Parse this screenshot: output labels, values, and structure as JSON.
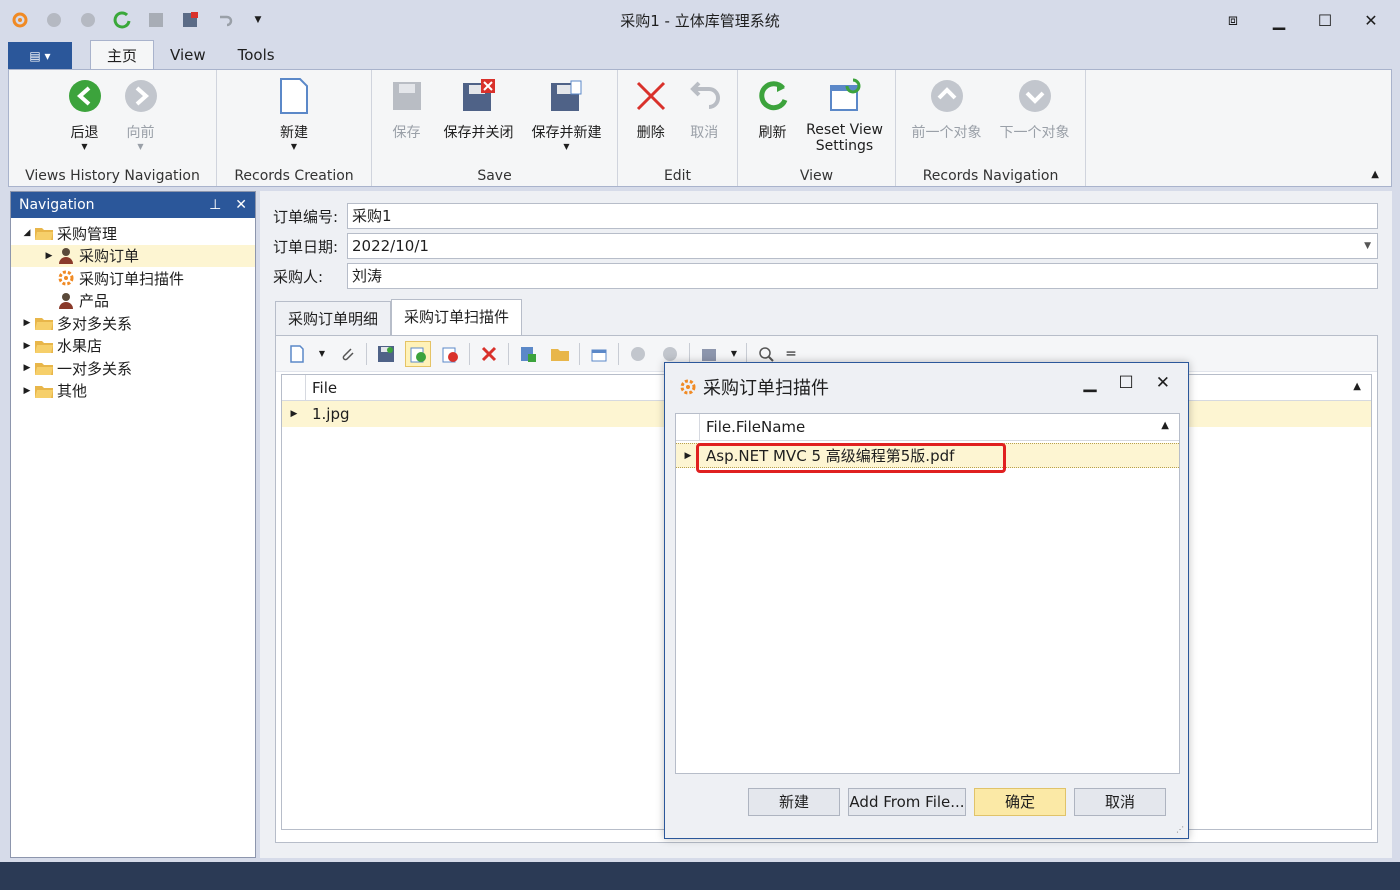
{
  "window": {
    "title": "采购1 - 立体库管理系统",
    "controls": [
      "restore-ribbon",
      "minimize",
      "maximize",
      "close"
    ]
  },
  "ribbon": {
    "tabs": [
      {
        "label": "主页",
        "active": true
      },
      {
        "label": "View",
        "active": false
      },
      {
        "label": "Tools",
        "active": false
      }
    ],
    "groups": {
      "history": {
        "title": "Views History Navigation",
        "back": "后退",
        "forward": "向前"
      },
      "creation": {
        "title": "Records Creation",
        "new": "新建"
      },
      "save": {
        "title": "Save",
        "save": "保存",
        "save_close": "保存并关闭",
        "save_new": "保存并新建"
      },
      "edit": {
        "title": "Edit",
        "delete": "删除",
        "cancel": "取消"
      },
      "view": {
        "title": "View",
        "refresh": "刷新",
        "reset_line1": "Reset View",
        "reset_line2": "Settings"
      },
      "records_nav": {
        "title": "Records Navigation",
        "prev": "前一个对象",
        "next": "下一个对象"
      }
    }
  },
  "navigation": {
    "title": "Navigation",
    "items": [
      {
        "label": "采购管理",
        "level": 0,
        "expanded": true,
        "icon": "folder-icon"
      },
      {
        "label": "采购订单",
        "level": 1,
        "selected": true,
        "icon": "user-icon"
      },
      {
        "label": "采购订单扫描件",
        "level": 1,
        "icon": "gear-icon"
      },
      {
        "label": "产品",
        "level": 1,
        "icon": "user-icon"
      },
      {
        "label": "多对多关系",
        "level": 0,
        "icon": "folder-icon"
      },
      {
        "label": "水果店",
        "level": 0,
        "icon": "folder-icon"
      },
      {
        "label": "一对多关系",
        "level": 0,
        "icon": "folder-icon"
      },
      {
        "label": "其他",
        "level": 0,
        "icon": "folder-icon"
      }
    ]
  },
  "form": {
    "order_no_label": "订单编号:",
    "order_no": "采购1",
    "order_date_label": "订单日期:",
    "order_date": "2022/10/1",
    "buyer_label": "采购人:",
    "buyer": "刘涛"
  },
  "tabs": [
    {
      "label": "采购订单明细",
      "active": false
    },
    {
      "label": "采购订单扫描件",
      "active": true
    }
  ],
  "file_grid": {
    "column": "File",
    "rows": [
      "1.jpg"
    ]
  },
  "dialog": {
    "title": "采购订单扫描件",
    "column": "File.FileName",
    "rows": [
      "Asp.NET MVC 5 高级编程第5版.pdf"
    ],
    "buttons": {
      "new": "新建",
      "add_from_file": "Add From File...",
      "ok": "确定",
      "cancel": "取消"
    }
  },
  "colors": {
    "accent": "#2b579a",
    "selection": "#fdf5d2",
    "highlight": "#e02020"
  }
}
